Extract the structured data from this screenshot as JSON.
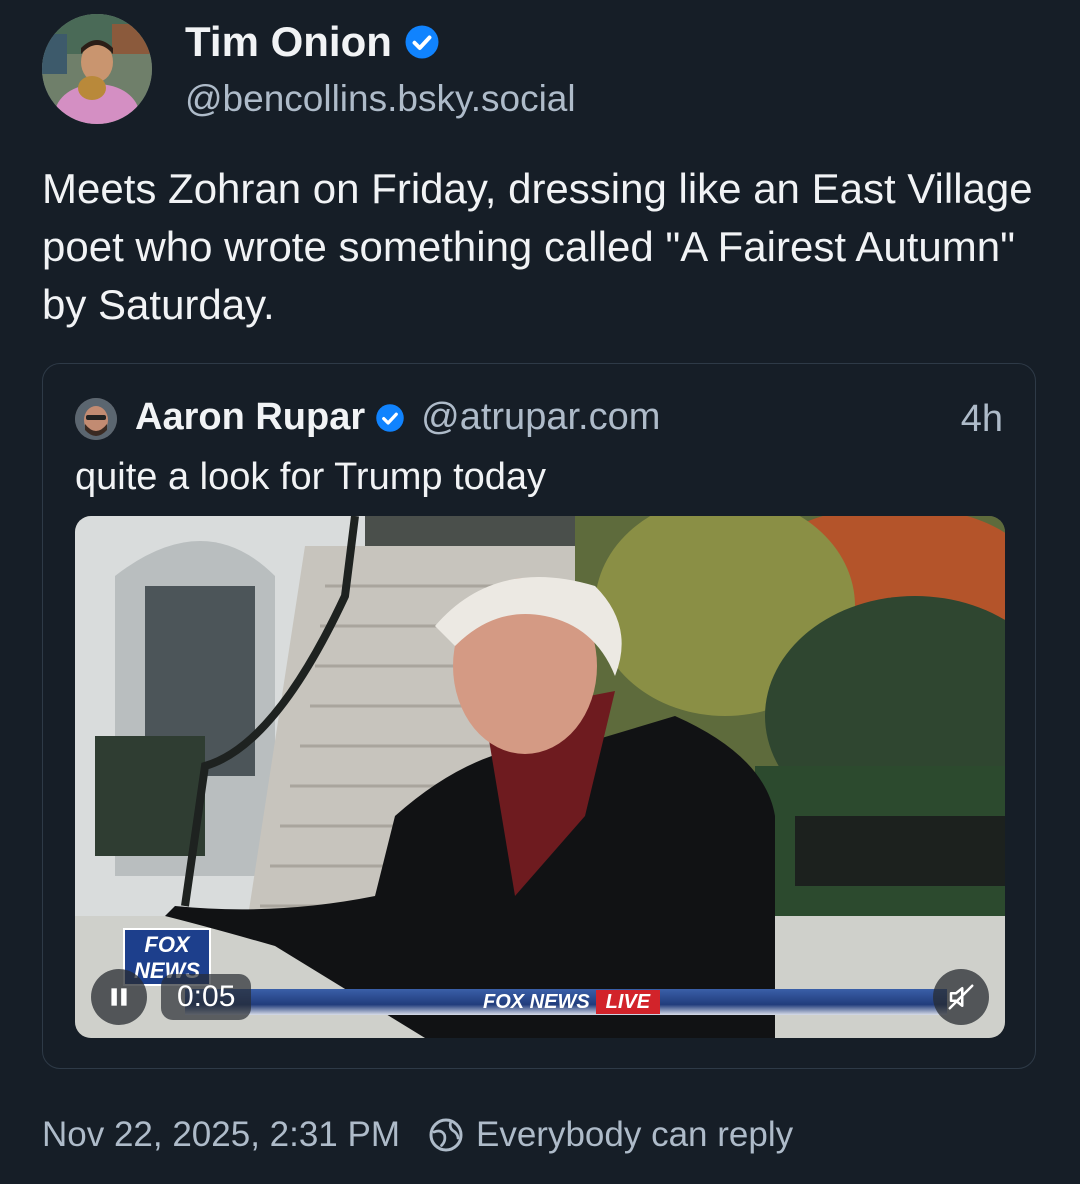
{
  "post": {
    "author_name": "Tim Onion",
    "author_handle": "@bencollins.bsky.social",
    "text": "Meets Zohran on Friday, dressing like an East Village poet who wrote something called \"A Fairest Autumn\" by Saturday."
  },
  "quote": {
    "author_name": "Aaron Rupar",
    "author_handle": "@atrupar.com",
    "time": "4h",
    "text": "quite a look for Trump today",
    "video": {
      "time_label": "0:05",
      "fox_logo": "FOX NEWS",
      "ticker_label": "FOX NEWS",
      "live_label": "LIVE"
    }
  },
  "footer": {
    "timestamp": "Nov 22, 2025, 2:31 PM",
    "reply_setting": "Everybody can reply"
  },
  "colors": {
    "background": "#161e27",
    "verified": "#1083fe",
    "muted_text": "#aebbc9"
  },
  "icons": [
    "verified-badge-icon",
    "pause-icon",
    "mute-icon",
    "globe-icon"
  ]
}
